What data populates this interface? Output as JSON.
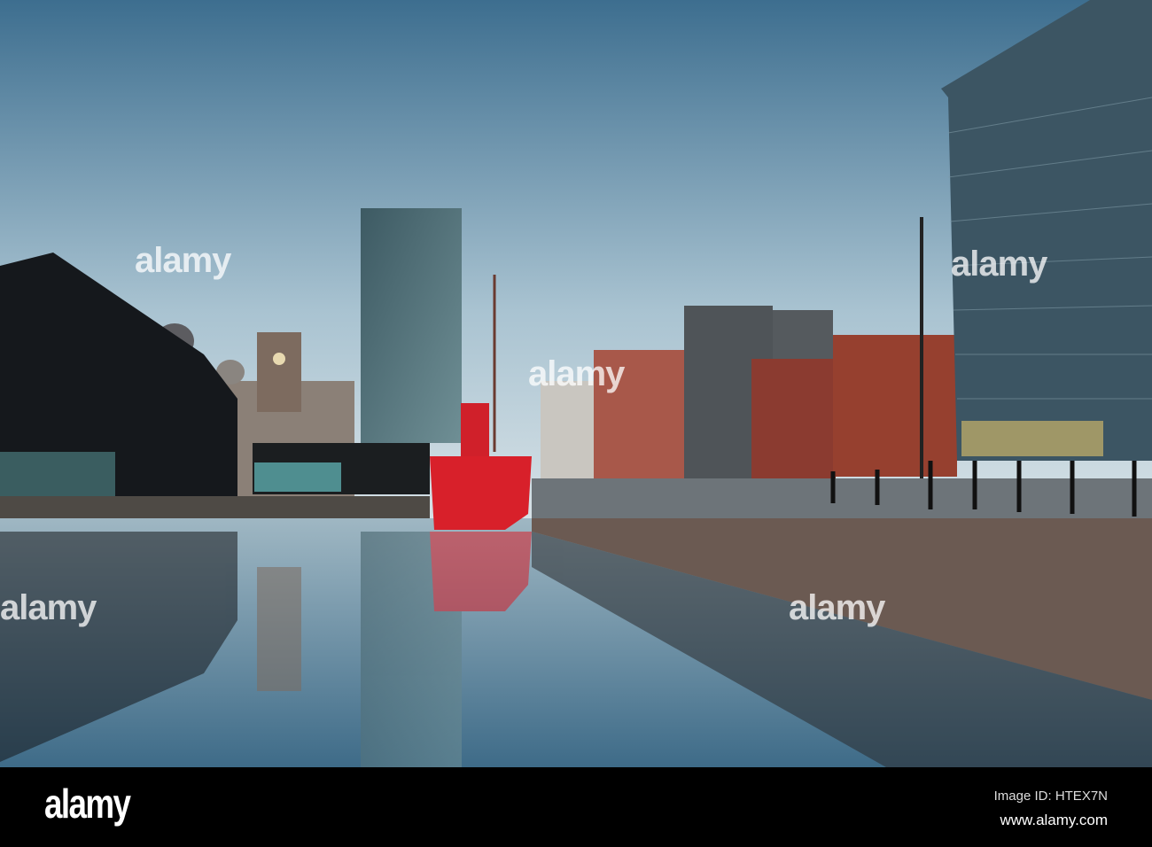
{
  "watermark": {
    "text": "alamy"
  },
  "footer": {
    "logo": "alamy",
    "image_id": "Image ID: HTEX7N",
    "website": "www.alamy.com"
  },
  "colors": {
    "sky_top": "#3d6e8f",
    "sky_horizon": "#d4e0e5",
    "ship": "#d8202a",
    "bar": "#000000"
  }
}
